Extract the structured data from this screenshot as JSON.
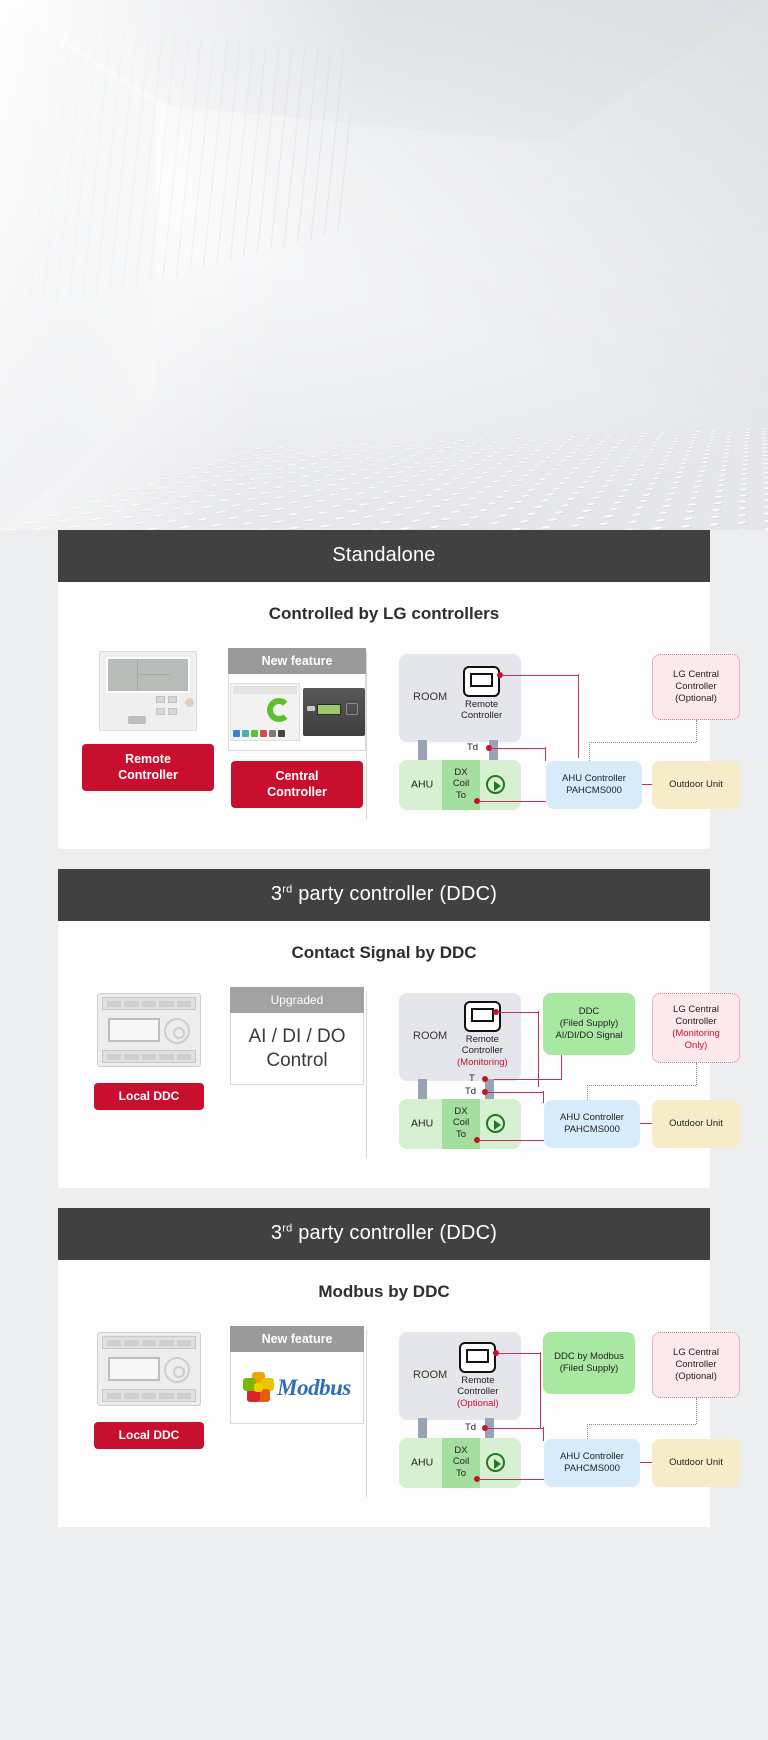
{
  "hero": {
    "alt": "perforated metal ceiling corridor"
  },
  "panels": [
    {
      "header": "Standalone",
      "header_sup": "",
      "title": "Controlled by LG controllers",
      "products": [
        {
          "type": "photo-remote",
          "badge": "Remote\nController",
          "badge_label_line1": "Remote",
          "badge_label_line2": "Controller",
          "ribbon": ""
        },
        {
          "type": "photo-central",
          "badge_label_line1": "Central",
          "badge_label_line2": "Controller",
          "ribbon": "New feature"
        }
      ],
      "diagram": {
        "room_label": "ROOM",
        "remote_caption_line1": "Remote",
        "remote_caption_line2": "Controller",
        "remote_caption_note": "",
        "td_label": "Td",
        "t_label": "",
        "to_label": "To",
        "ahu_label": "AHU",
        "coil_line1": "DX",
        "coil_line2": "Coil",
        "controller_line1": "AHU Controller",
        "controller_line2": "PAHCMS000",
        "outdoor_label": "Outdoor Unit",
        "center_box": null,
        "lgcc_line1": "LG Central",
        "lgcc_line2": "Controller",
        "lgcc_line3": "(Optional)",
        "lgcc_note": ""
      }
    },
    {
      "header": "3",
      "header_sup": "rd",
      "header_rest": " party controller (DDC)",
      "title": "Contact Signal by DDC",
      "products": [
        {
          "type": "photo-ddc",
          "badge_label_line1": "Local DDC",
          "badge_label_line2": "",
          "ribbon": ""
        },
        {
          "type": "feature-text",
          "ribbon": "Upgraded",
          "feature_line1": "AI / DI / DO",
          "feature_line2": "Control"
        }
      ],
      "diagram": {
        "room_label": "ROOM",
        "remote_caption_line1": "Remote",
        "remote_caption_line2": "Controller",
        "remote_caption_note": "(Monitoring)",
        "td_label": "Td",
        "t_label": "T",
        "to_label": "To",
        "ahu_label": "AHU",
        "coil_line1": "DX",
        "coil_line2": "Coil",
        "controller_line1": "AHU Controller",
        "controller_line2": "PAHCMS000",
        "outdoor_label": "Outdoor Unit",
        "center_box": {
          "line1": "DDC",
          "line2": "(Filed Supply)",
          "line3": "AI/DI/DO Signal"
        },
        "lgcc_line1": "LG Central",
        "lgcc_line2": "Controller",
        "lgcc_line3": "(Monitoring",
        "lgcc_note": "Only)"
      }
    },
    {
      "header": "3",
      "header_sup": "rd",
      "header_rest": " party controller (DDC)",
      "title": "Modbus by DDC",
      "products": [
        {
          "type": "photo-ddc",
          "badge_label_line1": "Local DDC",
          "badge_label_line2": "",
          "ribbon": ""
        },
        {
          "type": "modbus",
          "ribbon": "New feature",
          "logo_text": "Modbus"
        }
      ],
      "diagram": {
        "room_label": "ROOM",
        "remote_caption_line1": "Remote",
        "remote_caption_line2": "Controller",
        "remote_caption_note": "(Optional)",
        "td_label": "Td",
        "t_label": "",
        "to_label": "To",
        "ahu_label": "AHU",
        "coil_line1": "DX",
        "coil_line2": "Coil",
        "controller_line1": "AHU Controller",
        "controller_line2": "PAHCMS000",
        "outdoor_label": "Outdoor Unit",
        "center_box": {
          "line1": "DDC by Modbus",
          "line2": "(Filed Supply)",
          "line3": ""
        },
        "lgcc_line1": "LG Central",
        "lgcc_line2": "Controller",
        "lgcc_line3": "(Optional)",
        "lgcc_note": ""
      }
    }
  ],
  "colors": {
    "brand_red": "#c8102e",
    "header_dark": "#414141",
    "room_grey": "#e4e6ec",
    "ahu_green": "#d8f0d2",
    "coil_green": "#a5dfa0",
    "ctrl_blue": "#d6ecfa",
    "odu_cream": "#f6edc8",
    "ddc_green": "#a8e8a0",
    "lgcc_pink": "#fbe9ec",
    "wire_red": "#c43355"
  }
}
